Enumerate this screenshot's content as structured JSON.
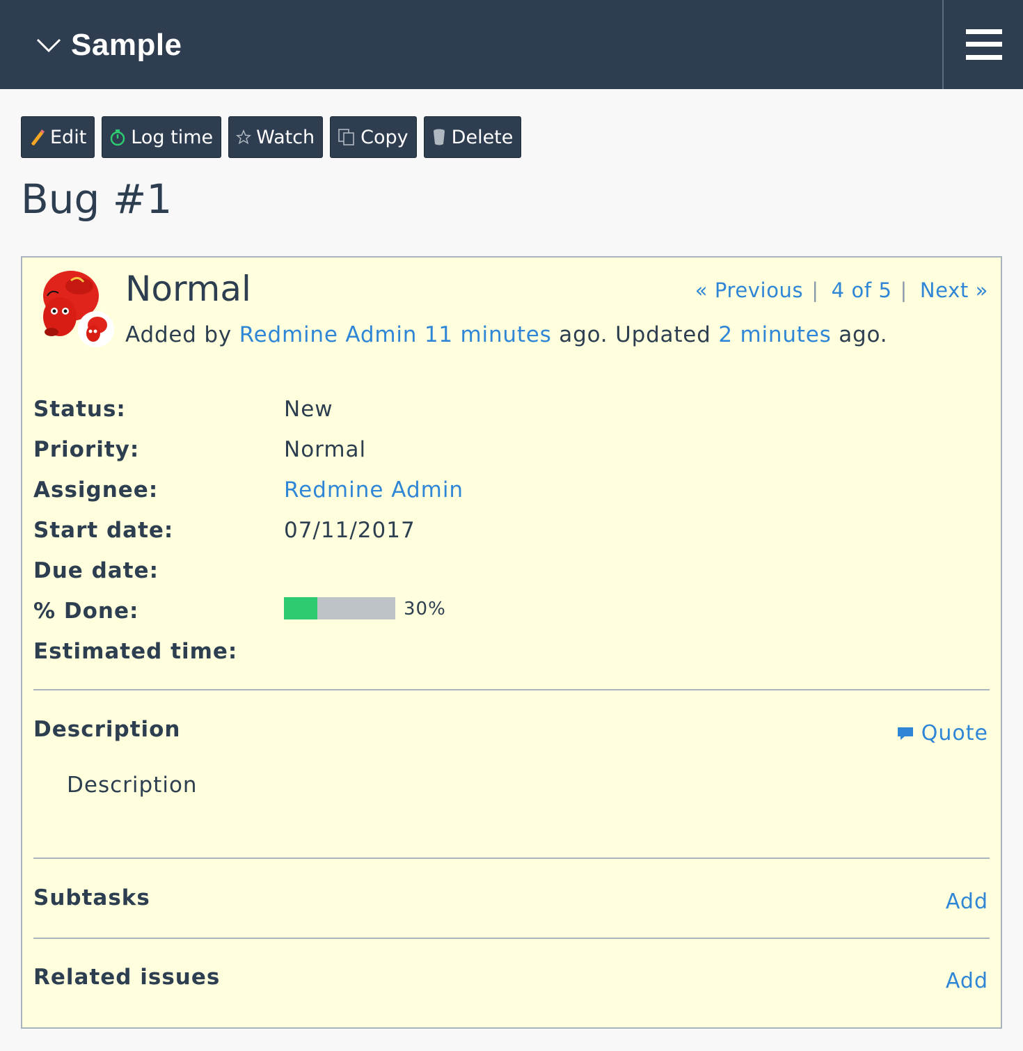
{
  "header": {
    "project_title": "Sample"
  },
  "toolbar": {
    "edit": "Edit",
    "log_time": "Log time",
    "watch": "Watch",
    "copy": "Copy",
    "delete": "Delete"
  },
  "page_title": "Bug #1",
  "issue": {
    "subject": "Normal",
    "added_by_prefix": "Added by",
    "author": "Redmine Admin",
    "created_ago": "11 minutes",
    "ago1": "ago. Updated",
    "updated_ago": "2 minutes",
    "ago2": "ago.",
    "pager": {
      "previous": "« Previous",
      "position": "4 of 5",
      "next": "Next »"
    },
    "attributes": [
      {
        "label": "Status:",
        "value": "New"
      },
      {
        "label": "Priority:",
        "value": "Normal"
      },
      {
        "label": "Assignee:",
        "value": "Redmine Admin"
      },
      {
        "label": "Start date:",
        "value": "07/11/2017"
      },
      {
        "label": "Due date:",
        "value": ""
      },
      {
        "label": "% Done:",
        "value": "30%"
      },
      {
        "label": "Estimated time:",
        "value": ""
      }
    ],
    "done_fraction": 0.3,
    "description_heading": "Description",
    "quote_label": "Quote",
    "description_text": "Description",
    "subtasks_heading": "Subtasks",
    "subtasks_add": "Add",
    "related_heading": "Related issues",
    "related_add": "Add"
  },
  "colors": {
    "header_bg": "#2e3d50",
    "issue_bg": "#ffffdd",
    "link": "#2f86d6",
    "progress_done": "#2ecc71",
    "progress_todo": "#bdc3c7"
  }
}
